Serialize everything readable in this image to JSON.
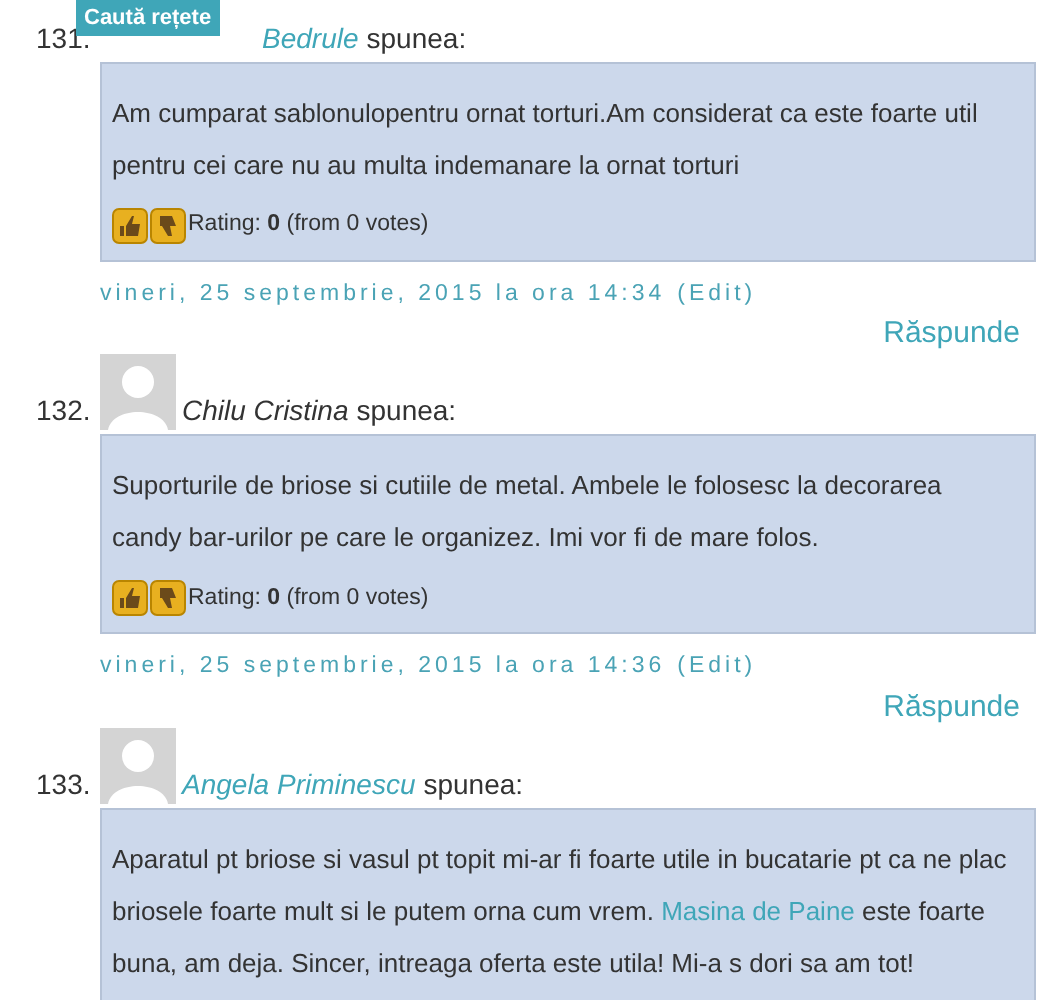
{
  "search_button": {
    "label": "Caută rețete"
  },
  "comments": [
    {
      "number": "131.",
      "author": "Bedrule",
      "author_linked": true,
      "avatar_visible": false,
      "says": "spunea:",
      "body": [
        {
          "text": "Am cumparat sablonulopentru ornat torturi.Am considerat ca este foarte util pentru cei care nu au multa indemanare la ornat torturi",
          "link": false
        }
      ],
      "rating": "Rating: **0** (from 0 votes)",
      "date": "vineri, 25 septembrie, 2015 la ora 14:34",
      "edit": "(Edit)",
      "reply": "Răspunde"
    },
    {
      "number": "132.",
      "author": "Chilu Cristina",
      "author_linked": false,
      "avatar_visible": true,
      "says": "spunea:",
      "body": [
        {
          "text": "Suporturile de briose si cutiile de metal. Ambele le folosesc la decorarea candy bar-urilor pe care le organizez. Imi vor fi de mare folos.",
          "link": false
        }
      ],
      "rating": "Rating: **0** (from 0 votes)",
      "date": "vineri, 25 septembrie, 2015 la ora 14:36",
      "edit": "(Edit)",
      "reply": "Răspunde"
    },
    {
      "number": "133.",
      "author": "Angela Priminescu",
      "author_linked": true,
      "avatar_visible": true,
      "says": "spunea:",
      "body": [
        {
          "text": "Aparatul pt briose si vasul pt topit mi-ar fi foarte utile in bucatarie pt ca ne plac briosele foarte mult si le putem orna cum vrem. ",
          "link": false
        },
        {
          "text": "Masina de Paine",
          "link": true
        },
        {
          "text": " este foarte buna, am deja. Sincer, intreaga oferta este utila! Mi-a s dori sa am tot!",
          "link": false
        }
      ]
    }
  ]
}
